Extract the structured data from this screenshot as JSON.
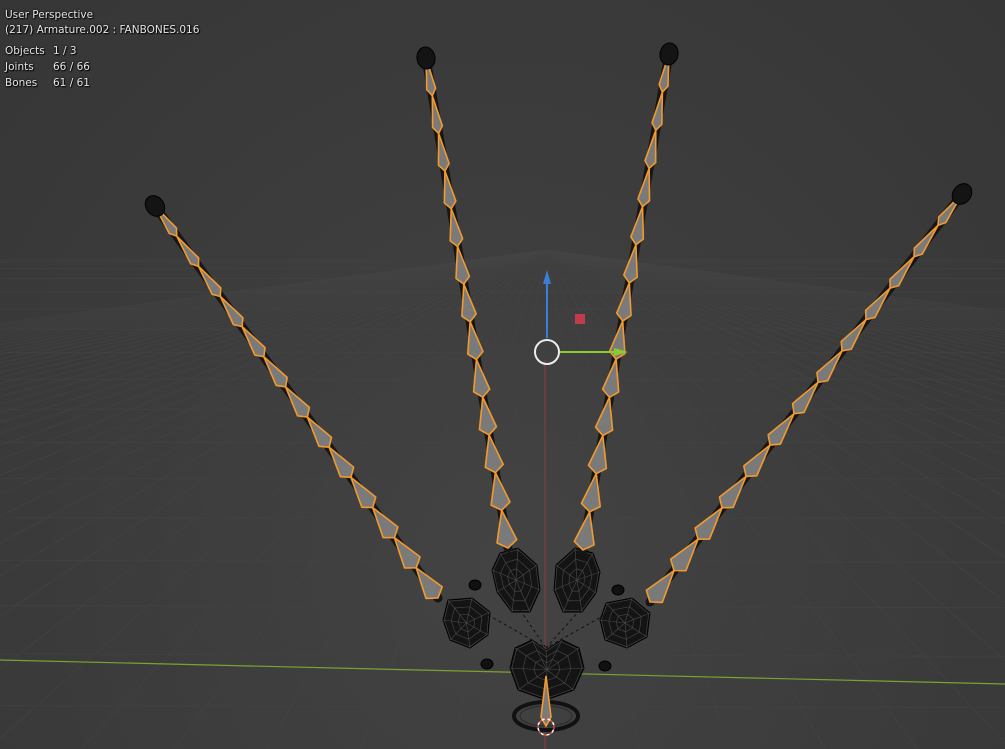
{
  "viewport": {
    "view_name": "User Perspective",
    "object_info": "(217) Armature.002 : FANBONES.016",
    "stats": [
      {
        "label": "Objects",
        "value": "1 / 3"
      },
      {
        "label": "Joints",
        "value": "66 / 66"
      },
      {
        "label": "Bones",
        "value": "61 / 61"
      }
    ]
  },
  "colors": {
    "background": "#3d3d3d",
    "grid": "#454545",
    "x_axis": "#9c3a3a",
    "y_axis": "#7fae33",
    "selection": "#f29a2e",
    "bone_fill": "#7a7a7a",
    "gizmo_z": "#3a7fd6",
    "gizmo_y": "#8ccc2c",
    "gizmo_plane": "#c23b4a"
  },
  "icons": {
    "cursor": "3d-cursor-icon",
    "gizmo": "transform-gizmo-icon"
  }
}
